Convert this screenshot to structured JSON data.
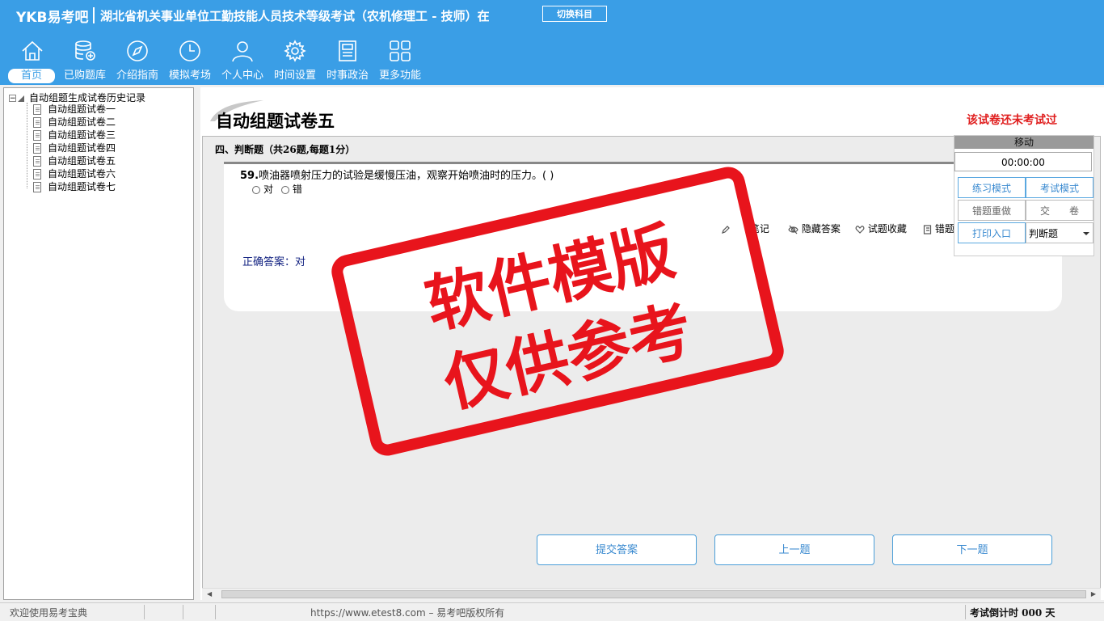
{
  "header": {
    "logo": "YKB易考吧",
    "title": "湖北省机关事业单位工勤技能人员技术等级考试（农机修理工 - 技师）在",
    "switch_label": "切换科目",
    "background": "#3a9ee6",
    "nav": [
      {
        "label": "首页",
        "icon": "home-icon"
      },
      {
        "label": "已购题库",
        "icon": "database-icon"
      },
      {
        "label": "介绍指南",
        "icon": "compass-icon"
      },
      {
        "label": "模拟考场",
        "icon": "clock-icon"
      },
      {
        "label": "个人中心",
        "icon": "user-icon"
      },
      {
        "label": "时间设置",
        "icon": "gear-icon"
      },
      {
        "label": "时事政治",
        "icon": "newspaper-icon"
      },
      {
        "label": "更多功能",
        "icon": "grid-icon"
      }
    ]
  },
  "tree": {
    "root": "自动组题生成试卷历史记录",
    "items": [
      "自动组题试卷一",
      "自动组题试卷二",
      "自动组题试卷三",
      "自动组题试卷四",
      "自动组题试卷五",
      "自动组题试卷六",
      "自动组题试卷七"
    ]
  },
  "paper": {
    "title": "自动组题试卷五",
    "status": "该试卷还未考试过",
    "section": "四、判断题（共26题,每题1分）",
    "question_number": "59.",
    "question_text": "喷油器喷射压力的试验是缓慢压油，观察开始喷油时的压力。( )",
    "options": [
      "对",
      "错"
    ],
    "answer_label": "正确答案：",
    "answer_value": "对",
    "tools": [
      "笔记",
      "隐藏答案",
      "试题收藏",
      "错题"
    ]
  },
  "float_panel": {
    "move_label": "移动",
    "timer": "00:00:00",
    "practice_mode": "练习模式",
    "exam_mode": "考试模式",
    "redo_wrong": "错题重做",
    "submit_paper": "交　　卷",
    "print_entry": "打印入口",
    "question_type": "判断题"
  },
  "buttons": {
    "submit": "提交答案",
    "prev": "上一题",
    "next": "下一题"
  },
  "stamp": {
    "line1": "软件模版",
    "line2": "仅供参考",
    "color": "#e8141c"
  },
  "statusbar": {
    "welcome": "欢迎使用易考宝典",
    "copyright": "https://www.etest8.com – 易考吧版权所有",
    "countdown": "考试倒计时 000 天"
  }
}
